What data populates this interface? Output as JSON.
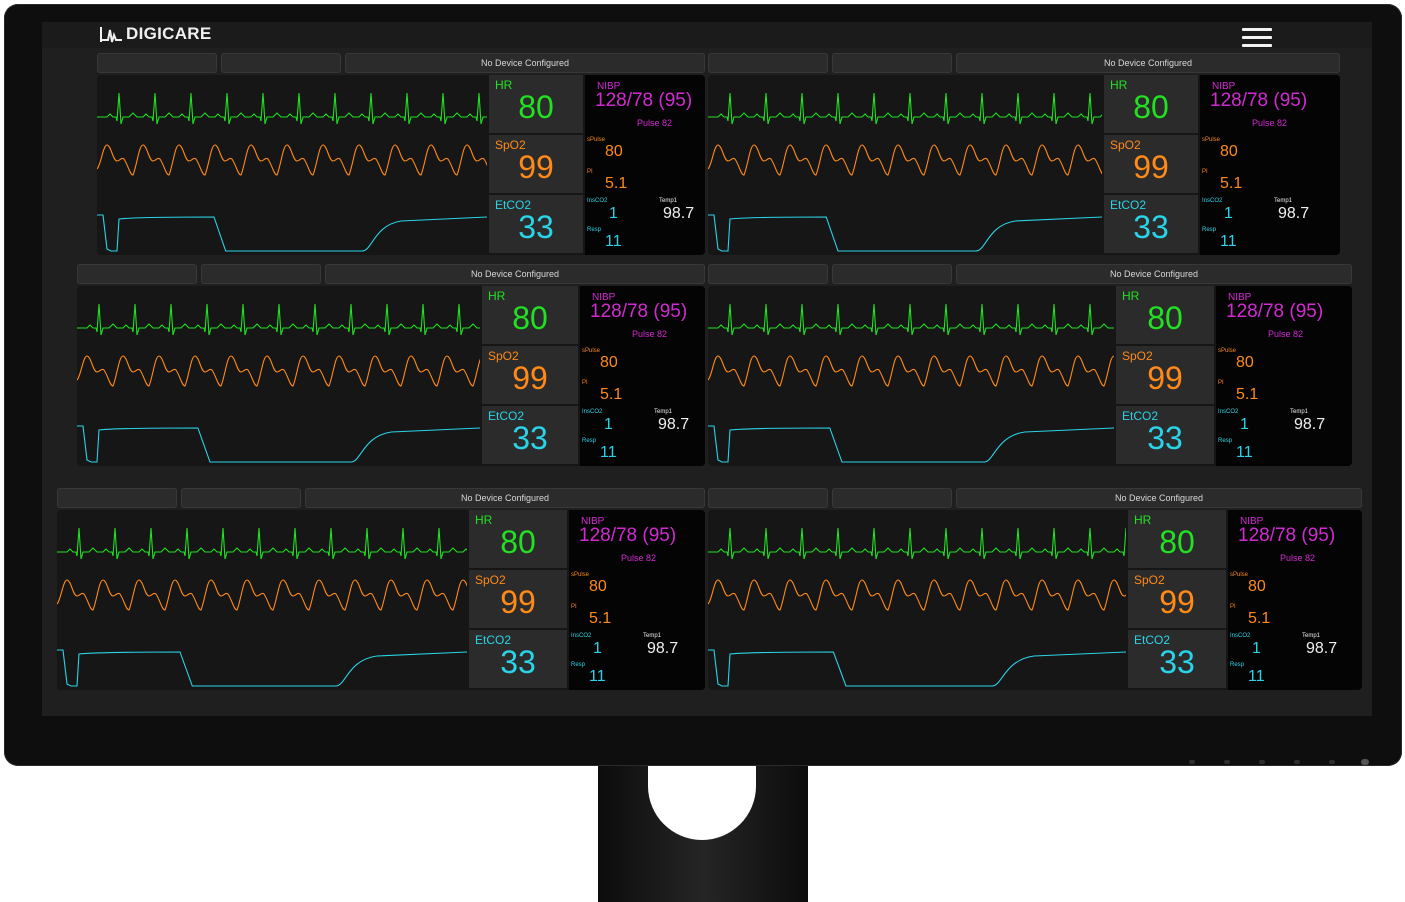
{
  "app": {
    "brand": "DIGICARE"
  },
  "menu": {
    "icon": "hamburger-menu-icon"
  },
  "colors": {
    "hr": "#22e022",
    "spo2": "#ff8a18",
    "co2": "#2ad4e8",
    "nibp": "#d22ad2",
    "temp": "#f0f0f0",
    "background": "#161616"
  },
  "labels": {
    "status": "No Device Configured",
    "hr": "HR",
    "spo2": "SpO2",
    "etco2": "EtCO2",
    "nibp": "NIBP",
    "spulse": "sPulse",
    "pi": "PI",
    "insco2": "InsCO2",
    "temp": "Temp1",
    "resp": "Resp"
  },
  "monitors": [
    {
      "hr": "80",
      "spo2": "99",
      "etco2": "33",
      "nibp": "128/78 (95)",
      "pulse": "Pulse 82",
      "spulse": "80",
      "pi": "5.1",
      "insco2": "1",
      "temp": "98.7",
      "resp": "11"
    },
    {
      "hr": "80",
      "spo2": "99",
      "etco2": "33",
      "nibp": "128/78 (95)",
      "pulse": "Pulse 82",
      "spulse": "80",
      "pi": "5.1",
      "insco2": "1",
      "temp": "98.7",
      "resp": "11"
    },
    {
      "hr": "80",
      "spo2": "99",
      "etco2": "33",
      "nibp": "128/78 (95)",
      "pulse": "Pulse 82",
      "spulse": "80",
      "pi": "5.1",
      "insco2": "1",
      "temp": "98.7",
      "resp": "11"
    },
    {
      "hr": "80",
      "spo2": "99",
      "etco2": "33",
      "nibp": "128/78 (95)",
      "pulse": "Pulse 82",
      "spulse": "80",
      "pi": "5.1",
      "insco2": "1",
      "temp": "98.7",
      "resp": "11"
    },
    {
      "hr": "80",
      "spo2": "99",
      "etco2": "33",
      "nibp": "128/78 (95)",
      "pulse": "Pulse 82",
      "spulse": "80",
      "pi": "5.1",
      "insco2": "1",
      "temp": "98.7",
      "resp": "11"
    },
    {
      "hr": "80",
      "spo2": "99",
      "etco2": "33",
      "nibp": "128/78 (95)",
      "pulse": "Pulse 82",
      "spulse": "80",
      "pi": "5.1",
      "insco2": "1",
      "temp": "98.7",
      "resp": "11"
    }
  ]
}
